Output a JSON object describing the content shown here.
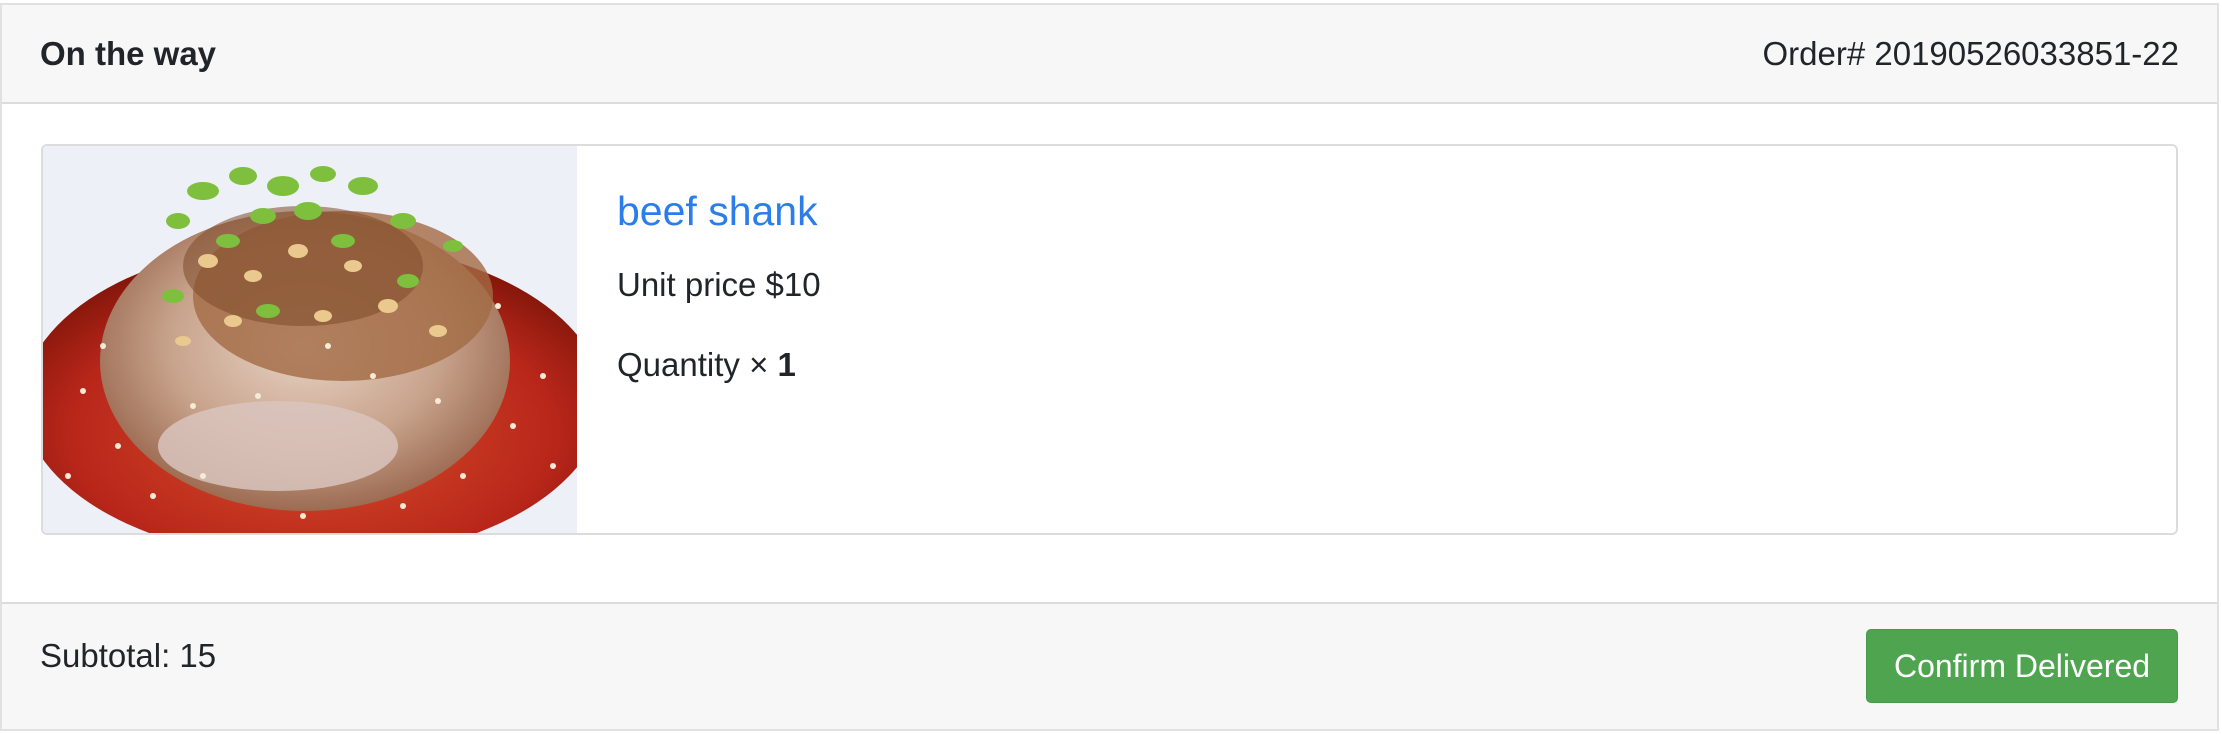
{
  "order": {
    "status": "On the way",
    "order_number": "Order# 20190526033851-22"
  },
  "item": {
    "image": "dish-photo",
    "name": "beef shank",
    "unit_price": "Unit price $10",
    "quantity_label": "Quantity × ",
    "quantity_value": "1"
  },
  "footer": {
    "subtotal": "Subtotal: 15",
    "confirm_label": "Confirm Delivered"
  },
  "colors": {
    "link": "#2b7de9",
    "confirm_button": "#4fa54f",
    "header_bg": "#f7f7f7"
  }
}
